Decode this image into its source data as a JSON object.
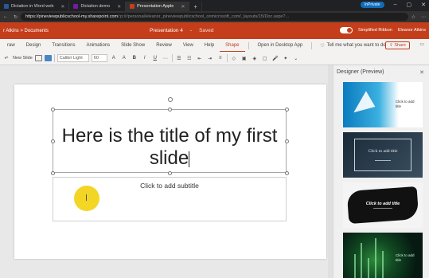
{
  "browser": {
    "tabs": [
      {
        "label": "Dictation in Word web",
        "color": "#2b579a",
        "active": false
      },
      {
        "label": "Dictation demo",
        "color": "#7719aa",
        "active": false
      },
      {
        "label": "Presentation Apple",
        "color": "#c43e1c",
        "active": true
      }
    ],
    "profile": "InPrivate",
    "url_host": "https://pineviewpublicschool-my.sharepoint.com",
    "url_path": "/:p:/r/personal/eleanor_pineviewpublicschool_onmicrosoft_com/_layouts/15/Doc.aspx?..."
  },
  "app": {
    "breadcrumb_user": "r Atkins",
    "breadcrumb_sep": ">",
    "breadcrumb_folder": "Documents",
    "doc_title": "Presentation 4",
    "doc_sep": "-",
    "doc_status": "Saved",
    "simplified_ribbon": "Simplified Ribbon",
    "user_name": "Eleanor Atkins",
    "accent": "#c43e1c"
  },
  "ribbon": {
    "tabs": [
      "raw",
      "Design",
      "Transitions",
      "Animations",
      "Slide Show",
      "Review",
      "View",
      "Help",
      "Shape"
    ],
    "active_tab": "Shape",
    "open_desktop": "Open in Desktop App",
    "tell_me": "Tell me what you want to do",
    "share": "Share",
    "new_slide": "New Slide",
    "font_name": "Calibri Light",
    "font_size": "60"
  },
  "slide": {
    "title_line1": "Here is the title of my first",
    "title_line2": "slide",
    "subtitle_placeholder": "Click to add subtitle"
  },
  "designer": {
    "title": "Designer (Preview)",
    "thumbs": [
      {
        "label": "Click to add title"
      },
      {
        "label": "Click to add title"
      },
      {
        "label": "Click to add title"
      },
      {
        "label": "Click to add title"
      }
    ]
  }
}
